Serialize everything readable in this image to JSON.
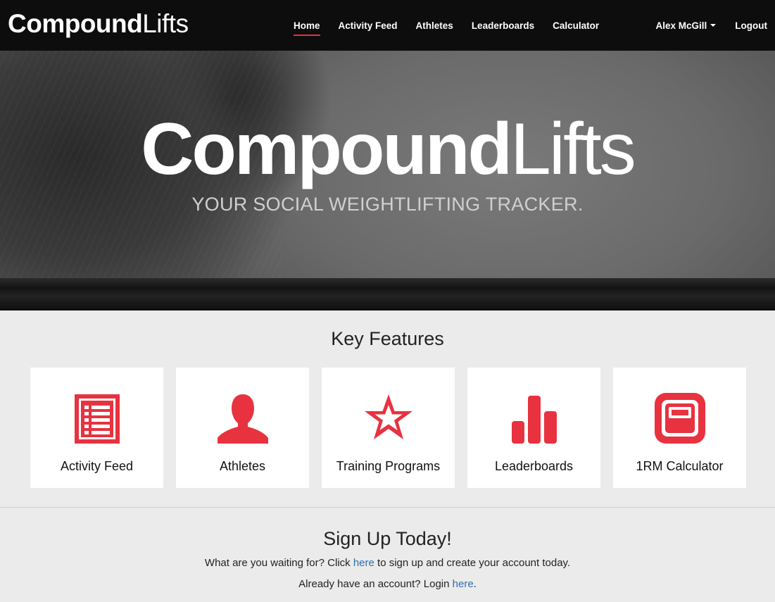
{
  "colors": {
    "accent": "#e8323f",
    "navbar_bg": "#0d0d0d",
    "link": "#2f6db5",
    "page_bg": "#ebebeb"
  },
  "navbar": {
    "brand_bold": "Compound",
    "brand_light": "Lifts",
    "links": [
      {
        "label": "Home",
        "active": true
      },
      {
        "label": "Activity Feed"
      },
      {
        "label": "Athletes"
      },
      {
        "label": "Leaderboards"
      },
      {
        "label": "Calculator"
      }
    ],
    "user_name": "Alex McGill",
    "logout_label": "Logout"
  },
  "hero": {
    "title_bold": "Compound",
    "title_light": "Lifts",
    "tagline": "YOUR SOCIAL WEIGHTLIFTING TRACKER."
  },
  "features": {
    "title": "Key Features",
    "cards": [
      {
        "label": "Activity Feed",
        "icon": "list-document-icon"
      },
      {
        "label": "Athletes",
        "icon": "person-icon"
      },
      {
        "label": "Training Programs",
        "icon": "star-icon"
      },
      {
        "label": "Leaderboards",
        "icon": "bar-chart-icon"
      },
      {
        "label": "1RM Calculator",
        "icon": "calculator-icon"
      }
    ]
  },
  "signup": {
    "title": "Sign Up Today!",
    "line1_pre": "What are you waiting for? Click ",
    "line1_link": "here",
    "line1_post": " to sign up and create your account today.",
    "line2_pre": "Already have an account? Login ",
    "line2_link": "here",
    "line2_post": "."
  }
}
